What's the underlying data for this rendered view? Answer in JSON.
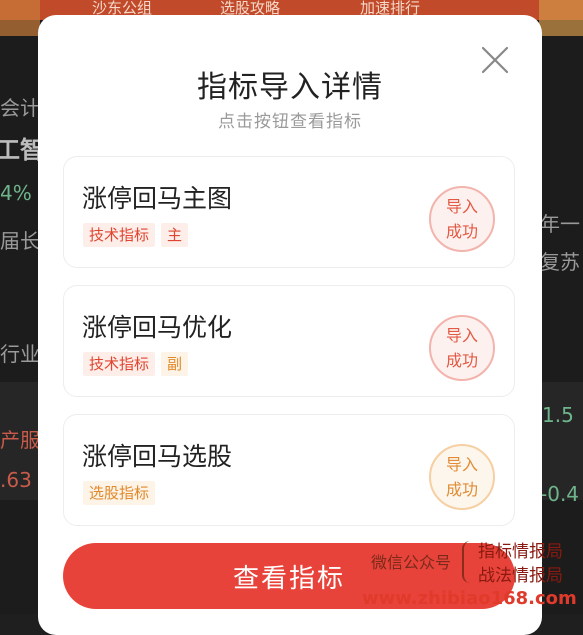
{
  "background": {
    "top_tabs": [
      "沙东公组",
      "选股攻略",
      "加速排行"
    ],
    "left_fragments": [
      "会计",
      "工智",
      "4%",
      "届长",
      "行业",
      "产服",
      ".63"
    ],
    "right_fragments": [
      "年一",
      "复苏",
      "1.5",
      "-0.4"
    ]
  },
  "modal": {
    "title": "指标导入详情",
    "subtitle": "点击按钮查看指标",
    "close_icon": "close-icon",
    "items": [
      {
        "name": "涨停回马主图",
        "tags": [
          {
            "label": "技术指标",
            "color": "#e0452f"
          },
          {
            "label": "主",
            "color": "#e0452f"
          }
        ],
        "status_line1": "导入",
        "status_line2": "成功",
        "status_color": "#e25a44"
      },
      {
        "name": "涨停回马优化",
        "tags": [
          {
            "label": "技术指标",
            "color": "#e0452f"
          },
          {
            "label": "副",
            "color": "#e08a2c"
          }
        ],
        "status_line1": "导入",
        "status_line2": "成功",
        "status_color": "#e25a44"
      },
      {
        "name": "涨停回马选股",
        "tags": [
          {
            "label": "选股指标",
            "color": "#e08a2c"
          }
        ],
        "status_line1": "导入",
        "status_line2": "成功",
        "status_color": "#e18c36"
      }
    ],
    "view_button_label": "查看指标",
    "accent_color": "#e8433a"
  },
  "watermark": {
    "left_text": "微信公众号",
    "right_line1": "指标情报局",
    "right_line2": "战法情报局",
    "url": "www.zhibiao168.com"
  }
}
